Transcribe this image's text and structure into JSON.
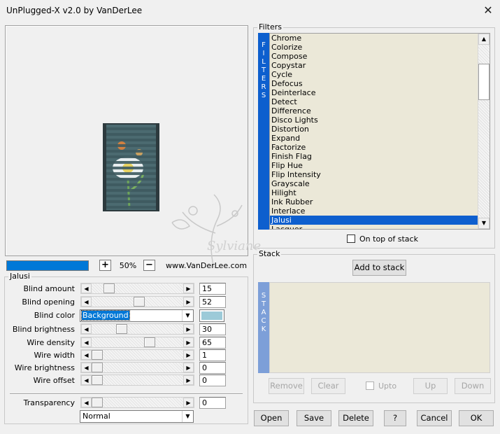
{
  "window": {
    "title": "UnPlugged-X v2.0 by VanDerLee",
    "close_glyph": "✕"
  },
  "preview": {
    "zoom_level": "50%",
    "zoom_plus": "+",
    "zoom_minus": "−",
    "website": "www.VanDerLee.com",
    "watermark_text": "Sylviane"
  },
  "jalusi": {
    "title": "Jalusi",
    "params": [
      {
        "label": "Blind amount",
        "value": "15",
        "fraction": 0.15
      },
      {
        "label": "Blind opening",
        "value": "52",
        "fraction": 0.52
      },
      {
        "label": "Blind color",
        "value": "Background"
      },
      {
        "label": "Blind brightness",
        "value": "30",
        "fraction": 0.3
      },
      {
        "label": "Wire density",
        "value": "65",
        "fraction": 0.65
      },
      {
        "label": "Wire width",
        "value": "1",
        "fraction": 0.0
      },
      {
        "label": "Wire brightness",
        "value": "0",
        "fraction": 0.0
      },
      {
        "label": "Wire offset",
        "value": "0",
        "fraction": 0.0
      }
    ],
    "blind_color_swatch": "#9ccad8",
    "transparency": {
      "label": "Transparency",
      "value": "0",
      "fraction": 0.0
    },
    "blend_mode": "Normal"
  },
  "filters": {
    "title": "Filters",
    "side_label": [
      "F",
      "I",
      "L",
      "T",
      "E",
      "R",
      "S"
    ],
    "items": [
      "Chrome",
      "Colorize",
      "Compose",
      "Copystar",
      "Cycle",
      "Defocus",
      "Deinterlace",
      "Detect",
      "Difference",
      "Disco Lights",
      "Distortion",
      "Expand",
      "Factorize",
      "Finish Flag",
      "Flip Hue",
      "Flip Intensity",
      "Grayscale",
      "Hilight",
      "Ink Rubber",
      "Interlace",
      "Jalusi",
      "Lacquer"
    ],
    "selected": "Jalusi",
    "on_top_of_stack": "On top of stack"
  },
  "stack": {
    "title": "Stack",
    "add_button": "Add to stack",
    "side_label": [
      "S",
      "T",
      "A",
      "C",
      "K"
    ],
    "remove": "Remove",
    "clear": "Clear",
    "upto": "Upto",
    "up": "Up",
    "down": "Down"
  },
  "buttons": {
    "open": "Open",
    "save": "Save",
    "delete": "Delete",
    "help": "?",
    "cancel": "Cancel",
    "ok": "OK"
  },
  "colors": {
    "accent": "#0d5fce",
    "progress": "#0078d7",
    "list_bg": "#ebe8d8"
  }
}
